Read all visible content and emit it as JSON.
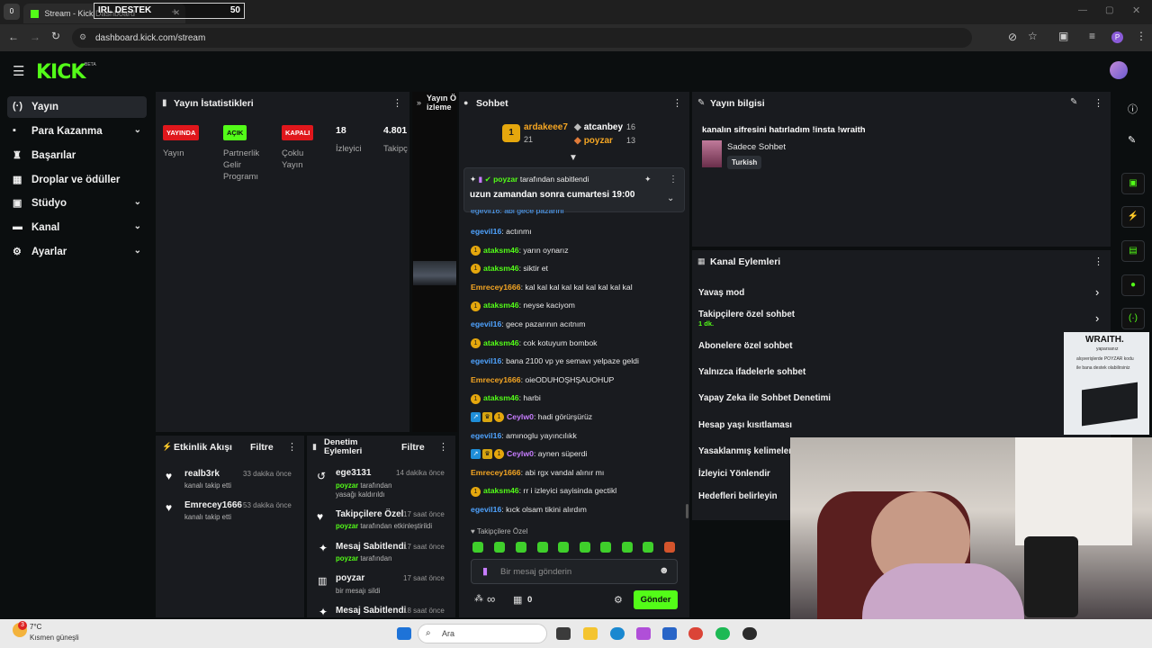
{
  "browser": {
    "tab_title": "Stream - Kick Dashboard",
    "overlay_text": "IRL DESTEK",
    "overlay_count": "50",
    "url": "dashboard.kick.com/stream"
  },
  "kick": {
    "logo": "KICK",
    "beta": "BETA"
  },
  "sidebar": {
    "items": [
      {
        "label": "Yayın",
        "icon": "broadcast-icon"
      },
      {
        "label": "Para Kazanma",
        "icon": "money-icon"
      },
      {
        "label": "Başarılar",
        "icon": "trophy-icon"
      },
      {
        "label": "Droplar ve ödüller",
        "icon": "drops-icon"
      },
      {
        "label": "Stüdyo",
        "icon": "studio-icon"
      },
      {
        "label": "Kanal",
        "icon": "channel-icon"
      },
      {
        "label": "Ayarlar",
        "icon": "gear-icon"
      }
    ]
  },
  "stats": {
    "title": "Yayın İstatistikleri",
    "live_badge": "YAYINDA",
    "live_label": "Yayın",
    "partner_badge": "AÇIK",
    "partner_label": "Partnerlik Gelir Programı",
    "multi_badge": "KAPALI",
    "multi_label": "Çoklu Yayın",
    "viewers_value": "18",
    "viewers_label": "İzleyici",
    "followers_value": "4.801",
    "followers_label": "Takipç"
  },
  "preview": {
    "title": "Yayın Ö izleme"
  },
  "activity": {
    "title": "Etkinlik Akışı",
    "filter": "Filtre",
    "items": [
      {
        "name": "realb3rk",
        "sub": "kanalı takip etti",
        "time": "33 dakika önce"
      },
      {
        "name": "Emrecey1666",
        "sub": "kanalı takip etti",
        "time": "53 dakika önce"
      }
    ]
  },
  "moderation": {
    "title": "Denetim Eylemleri",
    "filter": "Filtre",
    "items": [
      {
        "name": "ege3131",
        "actor": "poyzar",
        "sub": "tarafından yasağı kaldırıldı",
        "time": "14 dakika önce",
        "icon": "undo-icon"
      },
      {
        "name": "Takipçilere Özel",
        "actor": "poyzar",
        "sub": "tarafından etkinleştirildi",
        "time": "17 saat önce",
        "icon": "heart-icon"
      },
      {
        "name": "Mesaj Sabitlendi",
        "actor": "poyzar",
        "sub": "tarafından",
        "time": "17 saat önce",
        "icon": "pin-icon"
      },
      {
        "name": "poyzar",
        "actor": "",
        "sub": "bir mesajı sildi",
        "time": "17 saat önce",
        "icon": "trash-icon"
      },
      {
        "name": "Mesaj Sabitlendi",
        "actor": "",
        "sub": "",
        "time": "18 saat önce",
        "icon": "pin-icon"
      }
    ]
  },
  "chat": {
    "title": "Sohbet",
    "top": [
      {
        "name": "ardakeee7",
        "count": "21"
      },
      {
        "name": "atcanbey",
        "count": "16"
      },
      {
        "name": "poyzar",
        "count": "13"
      }
    ],
    "pinned_by": "poyzar",
    "pinned_by_suffix": "tarafından sabitlendi",
    "pinned_text": "uzun zamandan sonra cumartesi 19:00",
    "partial_line": "egevil16: abi gece pazarını",
    "messages": [
      {
        "user": "egevil16",
        "text": ": actınmı",
        "color": "#4fa3ff",
        "badges": ""
      },
      {
        "user": "ataksm46",
        "text": ": yarın oynarız",
        "color": "#53fc18",
        "badges": "1"
      },
      {
        "user": "ataksm46",
        "text": ": siktir et",
        "color": "#53fc18",
        "badges": "1"
      },
      {
        "user": "Emrecey1666",
        "text": ": kal kal kal kal kal kal kal kal kal",
        "color": "#f5a623",
        "badges": ""
      },
      {
        "user": "ataksm46",
        "text": ": neyse kaciyom",
        "color": "#53fc18",
        "badges": "1"
      },
      {
        "user": "egevil16",
        "text": ": gece pazarının acıtnım",
        "color": "#4fa3ff",
        "badges": ""
      },
      {
        "user": "ataksm46",
        "text": ": cok kotuyum bombok",
        "color": "#53fc18",
        "badges": "1"
      },
      {
        "user": "egevil16",
        "text": ": bana 2100 vp ye semavı yelpaze geldi",
        "color": "#4fa3ff",
        "badges": ""
      },
      {
        "user": "Emrecey1666",
        "text": ": oieODUHOŞHŞAUOHUP",
        "color": "#f5a623",
        "badges": ""
      },
      {
        "user": "ataksm46",
        "text": ": harbi",
        "color": "#53fc18",
        "badges": "1"
      },
      {
        "user": "Ceylw0",
        "text": ": hadi görürşürüz",
        "color": "#c77dff",
        "badges": "xc1"
      },
      {
        "user": "egevil16",
        "text": ": amınoglu yayıncılıkk",
        "color": "#4fa3ff",
        "badges": ""
      },
      {
        "user": "Ceylw0",
        "text": ": aynen süperdi",
        "color": "#c77dff",
        "badges": "xc1"
      },
      {
        "user": "Emrecey1666",
        "text": ": abi rgx vandal alınır mı",
        "color": "#f5a623",
        "badges": ""
      },
      {
        "user": "ataksm46",
        "text": ": rr i izleyici sayisinda gectikl",
        "color": "#53fc18",
        "badges": "1"
      },
      {
        "user": "egevil16",
        "text": ": kıck olsam tikini alırdım",
        "color": "#4fa3ff",
        "badges": ""
      }
    ],
    "followers_only": "Takipçilere Özel",
    "input_placeholder": "Bir mesaj gönderin",
    "infinity": "∞",
    "gift_count": "0",
    "send": "Gönder"
  },
  "stream_info": {
    "title": "Yayın bilgisi",
    "stream_title": "kanalın sifresini hatırladım !insta !wraith",
    "category": "Sadece Sohbet",
    "language": "Turkish"
  },
  "channel_actions": {
    "title": "Kanal Eylemleri",
    "items": [
      {
        "label": "Yavaş mod",
        "sub": ""
      },
      {
        "label": "Takipçilere özel sohbet",
        "sub": "1 dk."
      },
      {
        "label": "Abonelere özel sohbet",
        "sub": ""
      },
      {
        "label": "Yalnızca ifadelerle sohbet",
        "sub": ""
      },
      {
        "label": "Yapay Zeka ile Sohbet Denetimi",
        "sub": ""
      },
      {
        "label": "Hesap yaşı kısıtlaması",
        "sub": ""
      },
      {
        "label": "Yasaklanmış kelimeler",
        "sub": ""
      },
      {
        "label": "İzleyici Yönlendir",
        "sub": ""
      },
      {
        "label": "Hedefleri belirleyin",
        "sub": ""
      }
    ]
  },
  "ad": {
    "brand": "WRAITH.",
    "line1": "yaparsanız",
    "line2": "alışverişlerde POYZAR kodu",
    "line3": "ile bana destek olabilirsiniz"
  },
  "taskbar": {
    "temp": "7°C",
    "weather": "Kısmen güneşli",
    "search": "Ara",
    "notif": "3"
  }
}
